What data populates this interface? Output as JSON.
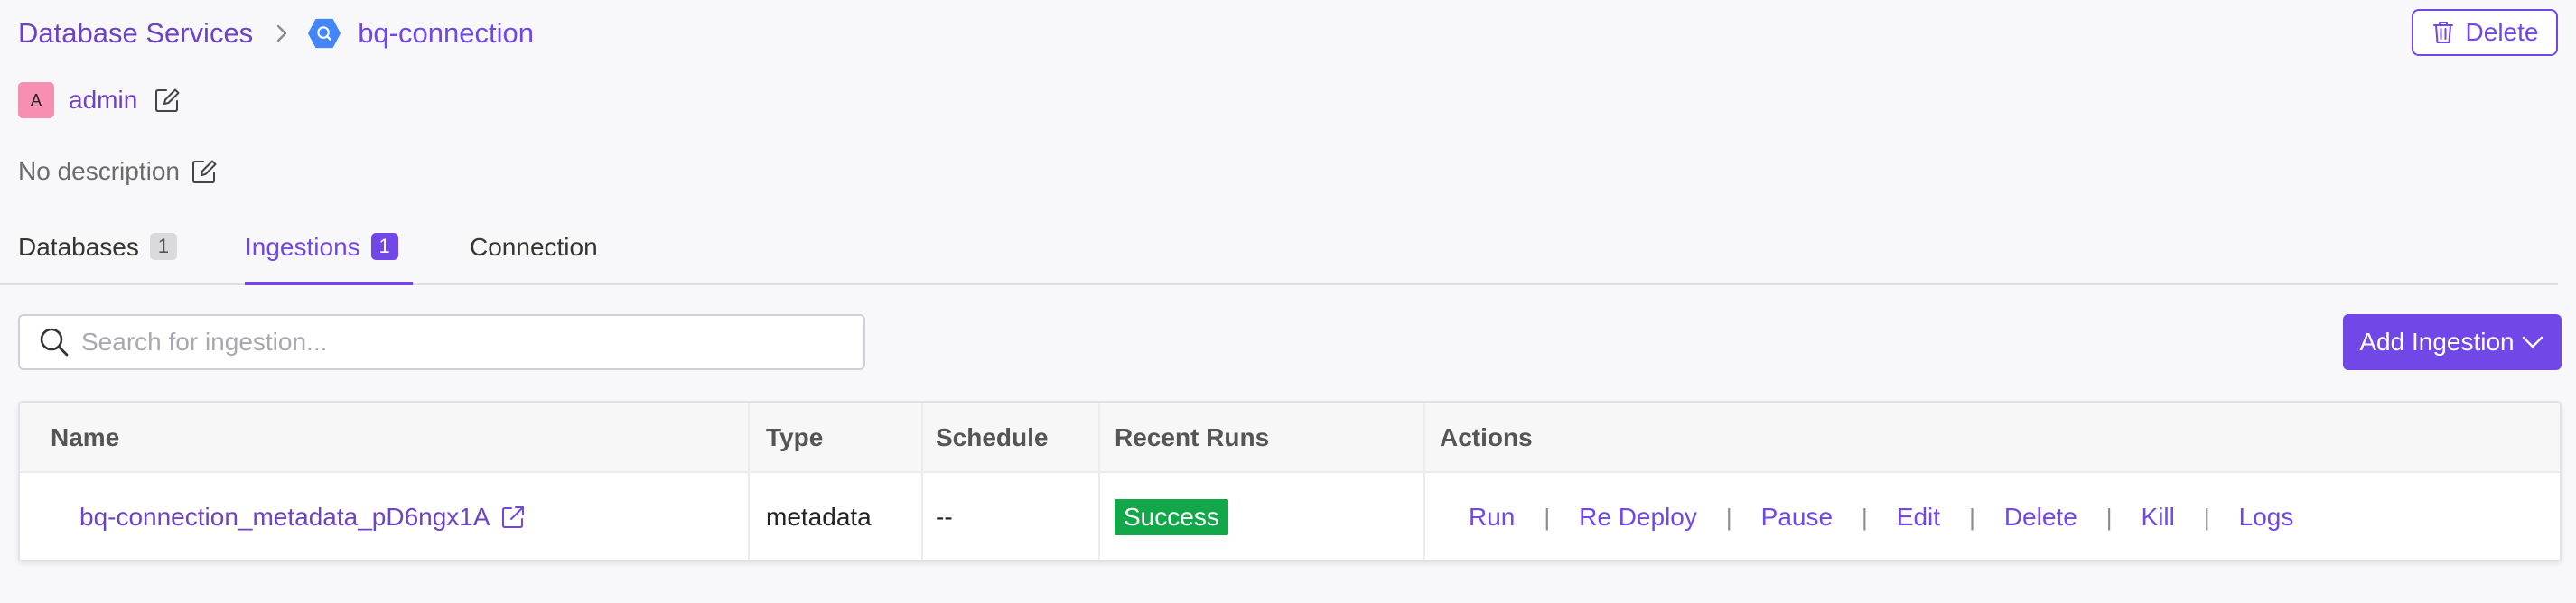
{
  "breadcrumb": {
    "parent": "Database Services",
    "current": "bq-connection",
    "service_icon": "bigquery-icon"
  },
  "header": {
    "delete_label": "Delete"
  },
  "owner": {
    "avatar_letter": "A",
    "name": "admin"
  },
  "description": {
    "text": "No description"
  },
  "tabs": [
    {
      "label": "Databases",
      "count": "1",
      "active": false
    },
    {
      "label": "Ingestions",
      "count": "1",
      "active": true
    },
    {
      "label": "Connection",
      "count": null,
      "active": false
    }
  ],
  "search": {
    "placeholder": "Search for ingestion...",
    "value": ""
  },
  "add_ingestion": {
    "label": "Add Ingestion"
  },
  "table": {
    "columns": [
      "Name",
      "Type",
      "Schedule",
      "Recent Runs",
      "Actions"
    ],
    "rows": [
      {
        "name": "bq-connection_metadata_pD6ngx1A",
        "type": "metadata",
        "schedule": "--",
        "recent_run": "Success",
        "actions": [
          "Run",
          "Re Deploy",
          "Pause",
          "Edit",
          "Delete",
          "Kill",
          "Logs"
        ]
      }
    ]
  },
  "colors": {
    "accent": "#7147e8",
    "success": "#12a84a",
    "avatar_bg": "#f78fb3"
  }
}
